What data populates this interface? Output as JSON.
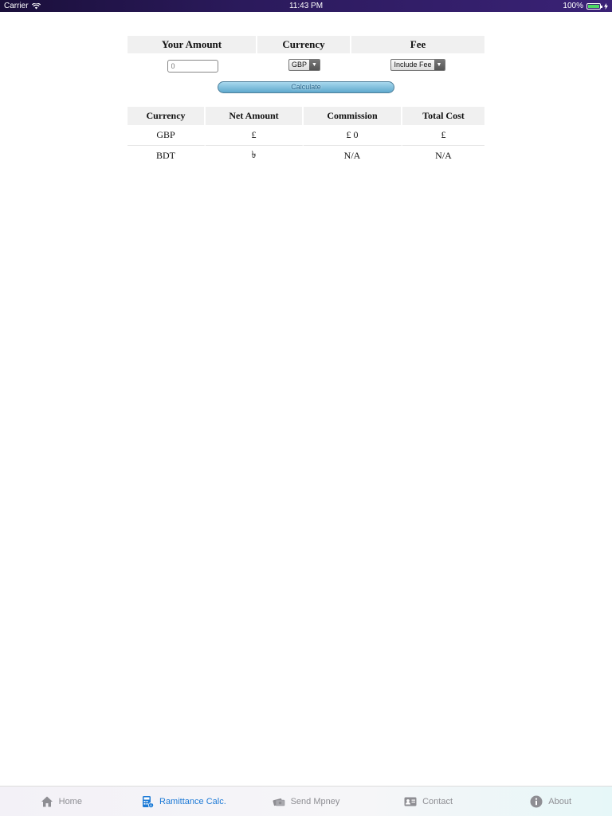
{
  "status_bar": {
    "carrier": "Carrier",
    "time": "11:43 PM",
    "battery": "100%"
  },
  "form": {
    "headers": [
      "Your Amount",
      "Currency",
      "Fee"
    ],
    "amount_placeholder": "0",
    "currency_selected": "GBP",
    "fee_selected": "Include Fee",
    "calculate_label": "Calculate"
  },
  "results": {
    "headers": [
      "Currency",
      "Net Amount",
      "Commission",
      "Total Cost"
    ],
    "rows": [
      {
        "currency": "GBP",
        "net": "£",
        "commission": "£ 0",
        "total": "£"
      },
      {
        "currency": "BDT",
        "net": "৳",
        "commission": "N/A",
        "total": "N/A"
      }
    ]
  },
  "tab_bar": {
    "items": [
      {
        "label": "Home",
        "icon": "home-icon",
        "active": false
      },
      {
        "label": "Ramittance Calc.",
        "icon": "calculator-icon",
        "active": true
      },
      {
        "label": "Send Mpney",
        "icon": "money-icon",
        "active": false
      },
      {
        "label": "Contact",
        "icon": "contact-card-icon",
        "active": false
      },
      {
        "label": "About",
        "icon": "info-icon",
        "active": false
      }
    ]
  },
  "colors": {
    "status_bar": "#2b1a5c",
    "active_tab": "#1d7ad6",
    "inactive_tab": "#8e8e93",
    "calculate_button": "#5fa9cd"
  }
}
